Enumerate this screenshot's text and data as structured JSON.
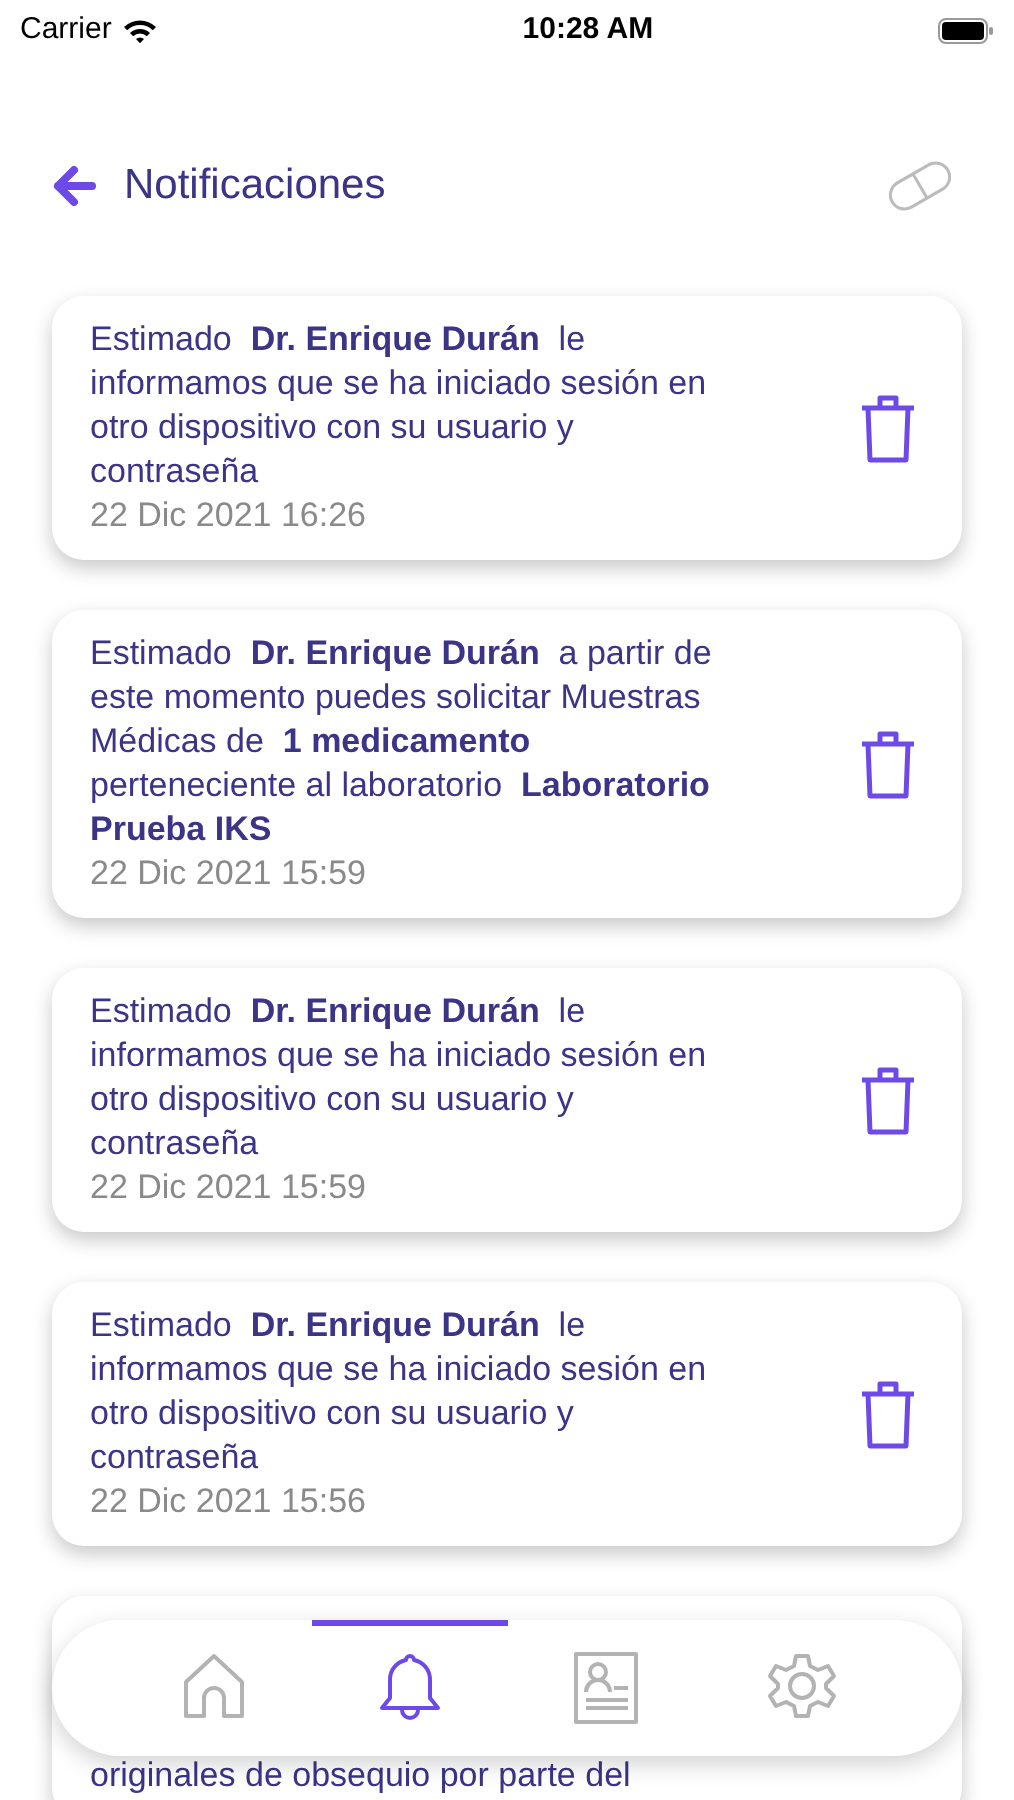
{
  "status_bar": {
    "carrier": "Carrier",
    "time": "10:28 AM"
  },
  "header": {
    "title": "Notificaciones"
  },
  "notifications": [
    {
      "message": "Estimado  **Dr. Enrique Durán**  le informamos que se ha iniciado sesión en otro dispositivo con su usuario y contraseña",
      "date": "22 Dic 2021 16:26"
    },
    {
      "message": "Estimado  **Dr. Enrique Durán**  a partir de este momento puedes solicitar Muestras Médicas de  **1 medicamento**  perteneciente al laboratorio  **Laboratorio Prueba IKS**",
      "date": "22 Dic 2021 15:59"
    },
    {
      "message": "Estimado  **Dr. Enrique Durán**  le informamos que se ha iniciado sesión en otro dispositivo con su usuario y contraseña",
      "date": "22 Dic 2021 15:59"
    },
    {
      "message": "Estimado  **Dr. Enrique Durán**  le informamos que se ha iniciado sesión en otro dispositivo con su usuario y contraseña",
      "date": "22 Dic 2021 15:56"
    },
    {
      "message": "originales de obsequio por parte del"
    }
  ],
  "tab_bar": [
    {
      "kind": "home",
      "selected": false
    },
    {
      "kind": "bell",
      "selected": true
    },
    {
      "kind": "profile",
      "selected": false
    },
    {
      "kind": "settings",
      "selected": false
    }
  ]
}
